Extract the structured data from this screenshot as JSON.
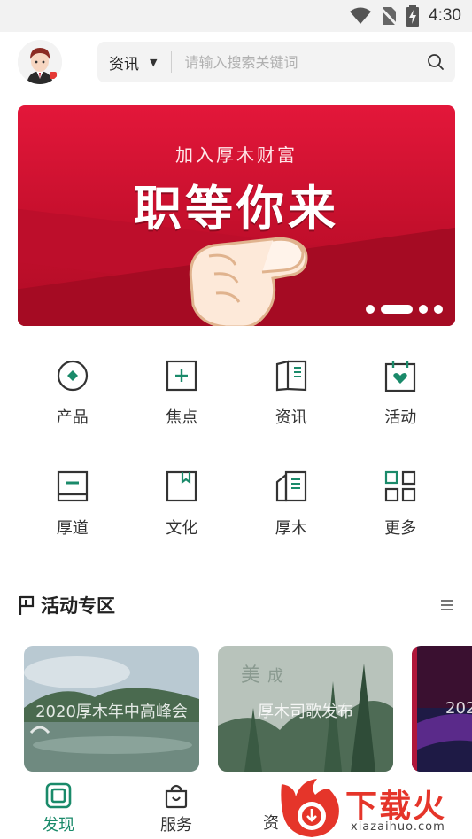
{
  "status_bar": {
    "time": "4:30"
  },
  "search": {
    "category": "资讯",
    "placeholder": "请输入搜索关键词"
  },
  "banner": {
    "subtitle": "加入厚木财富",
    "title": "职等你来",
    "slide_count": 4,
    "active_slide": 2
  },
  "grid": {
    "items": [
      {
        "label": "产品",
        "icon": "product-icon"
      },
      {
        "label": "焦点",
        "icon": "focus-icon"
      },
      {
        "label": "资讯",
        "icon": "news-icon"
      },
      {
        "label": "活动",
        "icon": "activity-icon"
      },
      {
        "label": "厚道",
        "icon": "integrity-icon"
      },
      {
        "label": "文化",
        "icon": "culture-icon"
      },
      {
        "label": "厚木",
        "icon": "houmu-icon"
      },
      {
        "label": "更多",
        "icon": "more-grid-icon"
      }
    ]
  },
  "section": {
    "title": "活动专区"
  },
  "cards": [
    {
      "caption": "2020厚木年中高峰会"
    },
    {
      "caption": "厚木司歌发布"
    },
    {
      "caption": "202"
    }
  ],
  "bottom_nav": {
    "items": [
      {
        "label": "发现",
        "active": true
      },
      {
        "label": "服务",
        "active": false
      },
      {
        "label": "资",
        "active": false
      }
    ]
  },
  "watermark": {
    "text": "下载火",
    "url": "xiazaihuo.com"
  },
  "colors": {
    "accent": "#1a8a6a",
    "banner_red": "#d9142f",
    "watermark_red": "#e5352a"
  }
}
